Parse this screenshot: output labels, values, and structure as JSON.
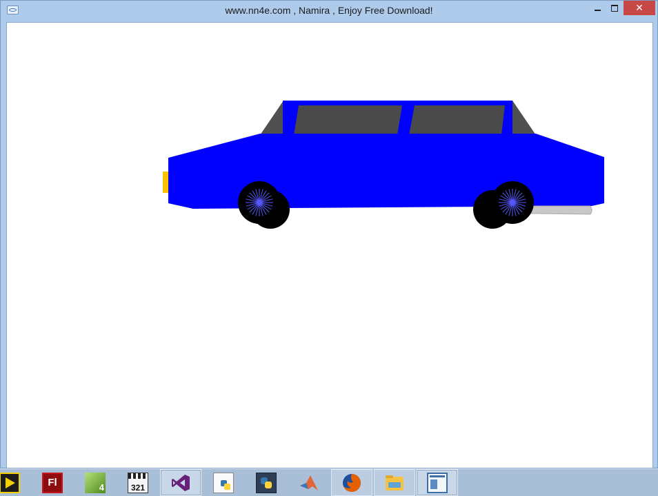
{
  "window": {
    "title": "www.nn4e.com , Namira , Enjoy Free Download!",
    "icon": "app-window-icon",
    "close_glyph": "✕"
  },
  "scene": {
    "car_body_color": "#0000ff",
    "window_color": "#4a4a4a",
    "roof_slope_color": "#505050",
    "headlight_color": "#ffc000",
    "exhaust_color": "#c8c8c8",
    "tire_color": "#000000",
    "spoke_color": "#5050ff"
  },
  "taskbar": {
    "items": [
      {
        "name": "labview-icon",
        "color": "#f3d000"
      },
      {
        "name": "flash-icon",
        "label": "Fl",
        "color": "#c4161c"
      },
      {
        "name": "green-app-icon",
        "label": "4",
        "color": "#76b82a"
      },
      {
        "name": "media-player-classic-icon",
        "label": "321",
        "color": "#f0f0f0"
      },
      {
        "name": "visual-studio-icon",
        "color": "#68217a"
      },
      {
        "name": "python-script-icon",
        "color": "#3776ab"
      },
      {
        "name": "python-ide-icon",
        "color": "#ffd43b"
      },
      {
        "name": "matlab-icon",
        "color": "#e16737"
      },
      {
        "name": "firefox-icon",
        "color": "#e66000"
      },
      {
        "name": "file-explorer-icon",
        "color": "#f5c242"
      },
      {
        "name": "window-app-icon",
        "color": "#3a6ea5"
      }
    ]
  }
}
